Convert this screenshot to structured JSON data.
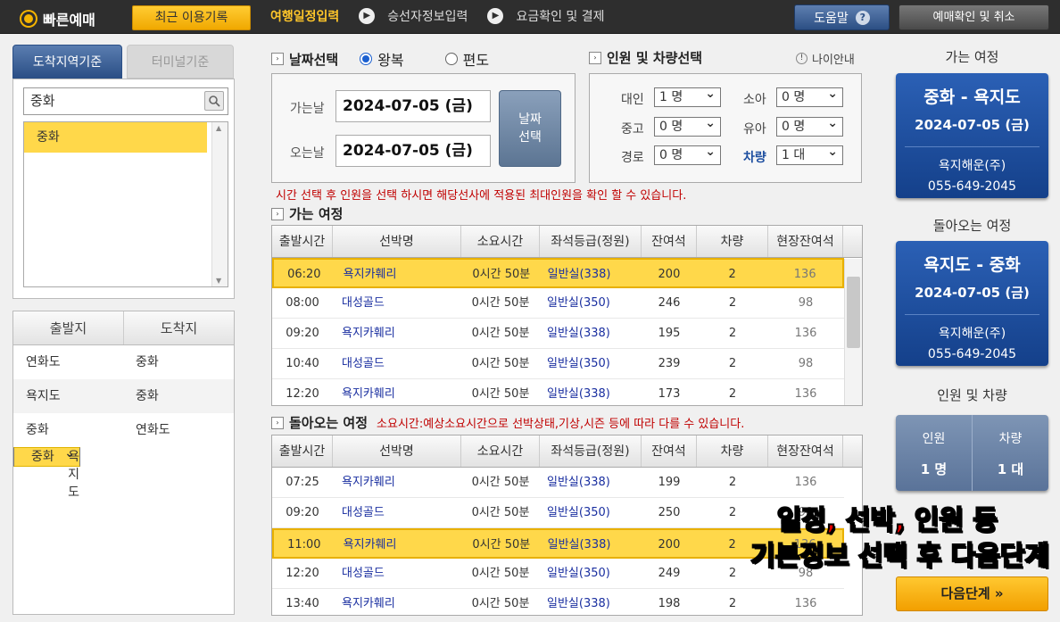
{
  "header": {
    "app_name": "빠른예매",
    "recent_label": "최근 이용기록",
    "steps": [
      "여행일정입력",
      "승선자정보입력",
      "요금확인 및 결제"
    ],
    "help_label": "도움말",
    "confirm_label": "예매확인 및 취소"
  },
  "left": {
    "tab_area": "도착지역기준",
    "tab_terminal": "터미널기준",
    "search_value": "중화",
    "list_selected": "중화",
    "routes_head": {
      "from": "출발지",
      "to": "도착지"
    },
    "routes": [
      {
        "from": "연화도",
        "to": "중화"
      },
      {
        "from": "욕지도",
        "to": "중화"
      },
      {
        "from": "중화",
        "to": "연화도"
      },
      {
        "from": "중화",
        "to": "욕지도"
      }
    ]
  },
  "date_section": {
    "title": "날짜선택",
    "roundtrip": "왕복",
    "oneway": "편도",
    "depart_label": "가는날",
    "depart_value": "2024-07-05 (금)",
    "return_label": "오는날",
    "return_value": "2024-07-05 (금)",
    "button": "날짜\n선택"
  },
  "pax_section": {
    "title": "인원 및 차량선택",
    "age_info": "나이안내",
    "adult": "대인",
    "adult_v": "1 명",
    "child": "소아",
    "child_v": "0 명",
    "teen": "중고",
    "teen_v": "0 명",
    "infant": "유아",
    "infant_v": "0 명",
    "senior": "경로",
    "senior_v": "0 명",
    "vehicle": "차량",
    "vehicle_v": "1 대"
  },
  "notice": "시간 선택 후 인원을 선택 하시면 해당선사에 적용된 최대인원을 확인 할 수 있습니다.",
  "outbound_title": "가는 여정",
  "return_title": "돌아오는 여정",
  "return_notice": "소요시간:예상소요시간으로 선박상태,기상,시즌 등에 따라 다를 수 있습니다.",
  "columns": [
    "출발시간",
    "선박명",
    "소요시간",
    "좌석등급(정원)",
    "잔여석",
    "차량",
    "현장잔여석"
  ],
  "outbound_rows": [
    [
      "06:20",
      "욕지카훼리",
      "0시간 50분",
      "일반실(338)",
      "200",
      "2",
      "136"
    ],
    [
      "08:00",
      "대성골드",
      "0시간 50분",
      "일반실(350)",
      "246",
      "2",
      "98"
    ],
    [
      "09:20",
      "욕지카훼리",
      "0시간 50분",
      "일반실(338)",
      "195",
      "2",
      "136"
    ],
    [
      "10:40",
      "대성골드",
      "0시간 50분",
      "일반실(350)",
      "239",
      "2",
      "98"
    ],
    [
      "12:20",
      "욕지카훼리",
      "0시간 50분",
      "일반실(338)",
      "173",
      "2",
      "136"
    ]
  ],
  "return_rows": [
    [
      "07:25",
      "욕지카훼리",
      "0시간 50분",
      "일반실(338)",
      "199",
      "2",
      "136"
    ],
    [
      "09:20",
      "대성골드",
      "0시간 50분",
      "일반실(350)",
      "250",
      "2",
      "98"
    ],
    [
      "11:00",
      "욕지카훼리",
      "0시간 50분",
      "일반실(338)",
      "200",
      "2",
      "136"
    ],
    [
      "12:20",
      "대성골드",
      "0시간 50분",
      "일반실(350)",
      "249",
      "2",
      "98"
    ],
    [
      "13:40",
      "욕지카훼리",
      "0시간 50분",
      "일반실(338)",
      "198",
      "2",
      "136"
    ]
  ],
  "right": {
    "out_title": "가는 여정",
    "out_route": "중화 - 욕지도",
    "out_date": "2024-07-05 (금)",
    "out_company": "욕지해운(주)",
    "out_tel": "055-649-2045",
    "ret_title": "돌아오는 여정",
    "ret_route": "욕지도 - 중화",
    "ret_date": "2024-07-05 (금)",
    "ret_company": "욕지해운(주)",
    "ret_tel": "055-649-2045",
    "pax_title": "인원 및 차량",
    "pax_label": "인원",
    "pax_value": "1 명",
    "car_label": "차량",
    "car_value": "1 대",
    "next_label": "다음단계 »"
  },
  "caption": {
    "line1": "일정, 선박, 인원 등",
    "line2": "기본정보 선택 후 다음단계"
  }
}
